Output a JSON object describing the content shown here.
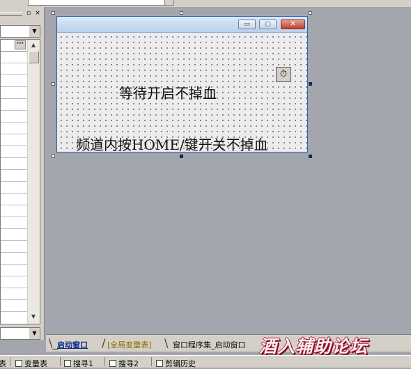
{
  "design_window": {
    "labels": [
      "等待开启不掉血",
      "频道内按HOME/键开关不掉血"
    ],
    "caption_buttons": {
      "minimize": "▭",
      "maximize": "▢",
      "close": "✕"
    }
  },
  "panel": {
    "restore": "▫",
    "close": "×"
  },
  "property_grid": {
    "ellipsis": "···"
  },
  "glyphs": {
    "dropdown": "▼",
    "scroll_up": "▲",
    "scroll_down": "▼",
    "timer": "⏱"
  },
  "tabs": [
    {
      "label": "启动窗口",
      "active": true
    },
    {
      "label": "[全局变量表]",
      "active": false
    },
    {
      "label": "窗口程序集_启动窗口",
      "active": false
    }
  ],
  "tab_separators": [
    "\\_",
    "/",
    "\\"
  ],
  "watermark": "酒入辅助论坛",
  "bottom_tabs": {
    "support": "表",
    "variables": "变量表",
    "search1": "搜寻1",
    "search2": "搜寻2",
    "clip_history": "剪辑历史"
  },
  "colors": {
    "workspace_bg": "#a4a6ad",
    "active_tab_text": "#0a2a8a",
    "global_tab_text": "#8a6a00",
    "watermark_outline": "#b0102e"
  }
}
